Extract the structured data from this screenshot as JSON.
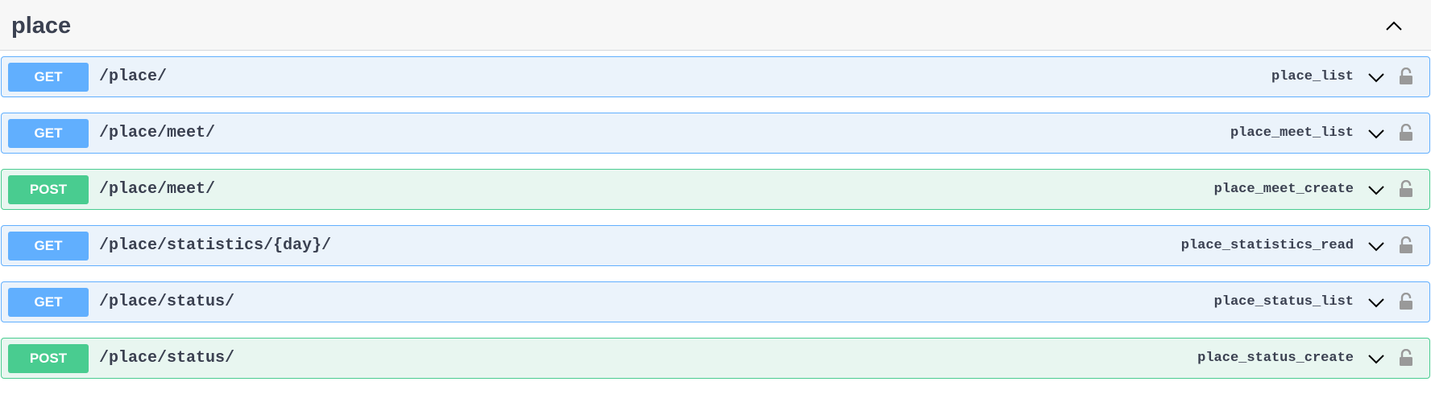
{
  "section": {
    "title": "place",
    "collapse_icon": "chevron-up-icon"
  },
  "colors": {
    "get": "#61affe",
    "get_bg": "#ebf3fb",
    "post": "#49cc90",
    "post_bg": "#e8f6f0",
    "text": "#3b4151",
    "lock": "#999999"
  },
  "operations": [
    {
      "method": "GET",
      "path": "/place/",
      "operation_id": "place_list"
    },
    {
      "method": "GET",
      "path": "/place/meet/",
      "operation_id": "place_meet_list"
    },
    {
      "method": "POST",
      "path": "/place/meet/",
      "operation_id": "place_meet_create"
    },
    {
      "method": "GET",
      "path": "/place/statistics/{day}/",
      "operation_id": "place_statistics_read"
    },
    {
      "method": "GET",
      "path": "/place/status/",
      "operation_id": "place_status_list"
    },
    {
      "method": "POST",
      "path": "/place/status/",
      "operation_id": "place_status_create"
    }
  ]
}
